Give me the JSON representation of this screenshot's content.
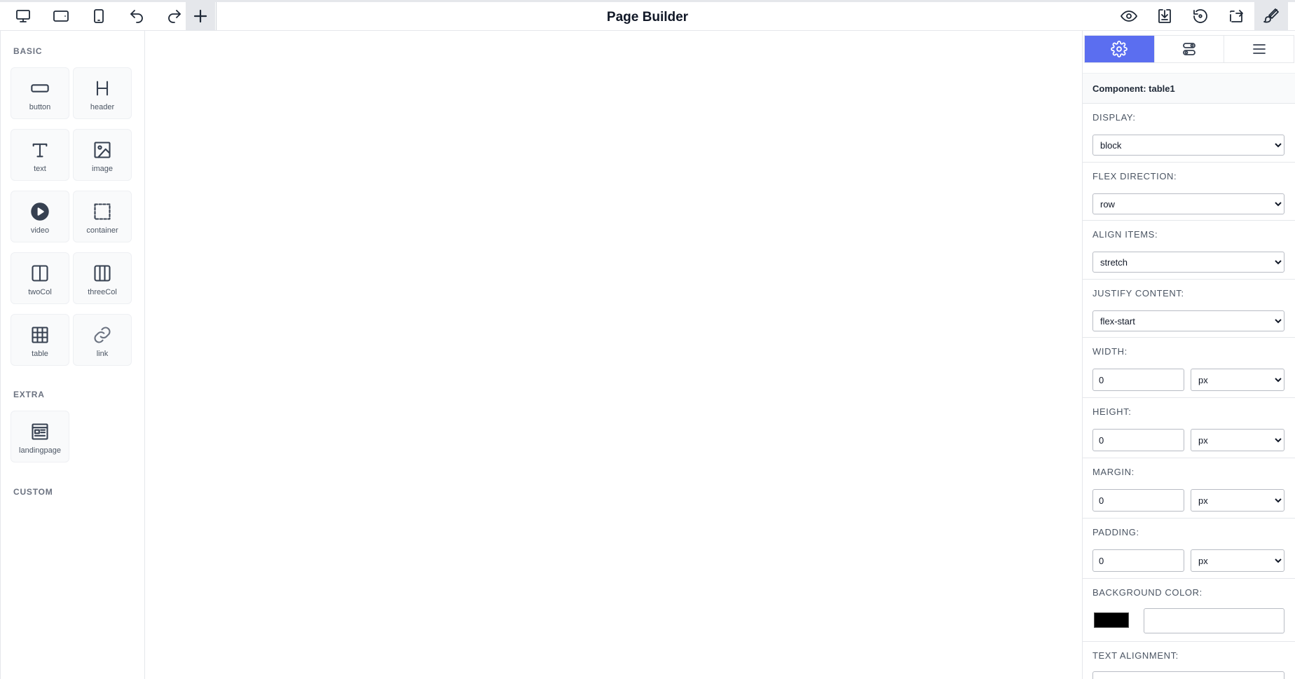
{
  "title": "Page Builder",
  "toolbar": {
    "left": [
      {
        "name": "desktop-view",
        "icon": "desktop-icon"
      },
      {
        "name": "tablet-landscape-view",
        "icon": "tablet-landscape-icon"
      },
      {
        "name": "mobile-view",
        "icon": "mobile-icon"
      },
      {
        "name": "undo",
        "icon": "undo-icon"
      },
      {
        "name": "redo",
        "icon": "redo-icon"
      },
      {
        "name": "add",
        "icon": "plus-icon",
        "active": true
      }
    ],
    "right": [
      {
        "name": "preview",
        "icon": "eye-icon"
      },
      {
        "name": "download",
        "icon": "download-icon"
      },
      {
        "name": "reset",
        "icon": "reset-icon"
      },
      {
        "name": "export",
        "icon": "export-icon"
      },
      {
        "name": "style-manager",
        "icon": "paint-brush-icon",
        "active": true
      }
    ]
  },
  "sidebar": {
    "sections": [
      {
        "label": "BASIC",
        "blocks": [
          {
            "label": "button",
            "icon": "button-icon"
          },
          {
            "label": "header",
            "icon": "header-icon"
          },
          {
            "label": "text",
            "icon": "text-icon"
          },
          {
            "label": "image",
            "icon": "image-icon"
          },
          {
            "label": "video",
            "icon": "video-icon"
          },
          {
            "label": "container",
            "icon": "container-icon"
          },
          {
            "label": "twoCol",
            "icon": "two-column-icon"
          },
          {
            "label": "threeCol",
            "icon": "three-column-icon"
          },
          {
            "label": "table",
            "icon": "table-icon"
          },
          {
            "label": "link",
            "icon": "link-icon"
          }
        ]
      },
      {
        "label": "EXTRA",
        "blocks": [
          {
            "label": "landingpage",
            "icon": "landing-page-icon"
          }
        ]
      },
      {
        "label": "CUSTOM",
        "blocks": []
      }
    ]
  },
  "panel": {
    "tabs": [
      {
        "name": "settings",
        "icon": "gear-icon",
        "active": true
      },
      {
        "name": "traits",
        "icon": "sliders-icon"
      },
      {
        "name": "layers",
        "icon": "menu-icon"
      }
    ],
    "component_label": "Component: table1",
    "props": {
      "display": {
        "label": "DISPLAY:",
        "value": "block"
      },
      "flex_direction": {
        "label": "FLEX DIRECTION:",
        "value": "row"
      },
      "align_items": {
        "label": "ALIGN ITEMS:",
        "value": "stretch"
      },
      "justify_content": {
        "label": "JUSTIFY CONTENT:",
        "value": "flex-start"
      },
      "width": {
        "label": "WIDTH:",
        "value": "0",
        "unit": "px"
      },
      "height": {
        "label": "HEIGHT:",
        "value": "0",
        "unit": "px"
      },
      "margin": {
        "label": "MARGIN:",
        "value": "0",
        "unit": "px"
      },
      "padding": {
        "label": "PADDING:",
        "value": "0",
        "unit": "px"
      },
      "background_color": {
        "label": "BACKGROUND COLOR:",
        "swatch": "#000000",
        "value": ""
      },
      "text_alignment": {
        "label": "TEXT ALIGNMENT:"
      }
    }
  },
  "colors": {
    "accent": "#5b6ef0"
  }
}
